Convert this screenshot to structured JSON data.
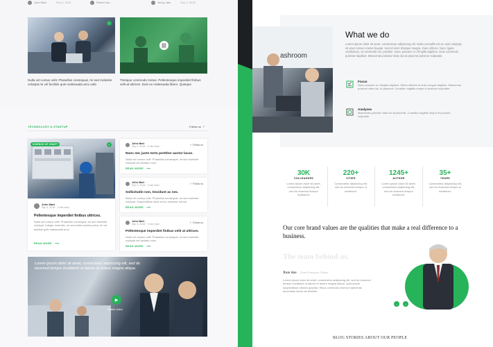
{
  "left": {
    "top_meta": [
      {
        "author": "John Mart",
        "date": "Sep 3, 2018"
      },
      {
        "author": "Robert Jan",
        "date": "Sep 2, 2018"
      }
    ],
    "top_meta_right": [
      {
        "author": "Jenny Jain",
        "date": "Sep 3, 2018"
      }
    ],
    "posts_row": [
      {
        "text": "Nulla vel cursus velit. Phasellus consequat, mi sed molestie volutpat mi vel facilisis quis malesuada arcu odio",
        "icon": "twitter-icon"
      },
      {
        "text": "Tristique commodo metus. Pellentesque imperdiet finibus velit at ultrices. Duis ex malesuada libero. Quisque",
        "icon": "link-icon"
      }
    ],
    "section_tag": "TECHNOLOGY & STARTUP",
    "follow_label": "Follow us",
    "featured": {
      "badge": "SCIENCE OF CRAFT",
      "author": "John Mart",
      "date": "Sep 3, 2018 · 3 min read",
      "title": "Pellentesque imperdiet finibus ultrices.",
      "excerpt": "Nulla vel cursus velit. Phasellus consequat, mi sed molestie volutpat. Integer molestie, mi sed mollis lacinia porta, mi vel facilisis quis malesuada arcu",
      "readmore": "READ MORE"
    },
    "side_posts": [
      {
        "author": "John Mart",
        "date": "Sep 3, 2018 · 3 min read",
        "follow": "Follow us",
        "title": "Nunc nec justo torto porttitor auctor lacus.",
        "excerpt": "Nulla vel cursus velit. Phasellus consequat, mi sed molestie volutpat vel facilisis nunc.",
        "readmore": "READ MORE"
      },
      {
        "author": "John Mart",
        "date": "Sep 3, 2018 · 3 min read",
        "follow": "Follow us",
        "title": "Sollicitudin non, tincidunt ac nec.",
        "excerpt": "Nulla vel cursus velit. Phasellus consequat, mi sed molestie volutpat. Suspendisse vitae et leo molestie rutrum.",
        "readmore": "READ MORE"
      },
      {
        "author": "John Mart",
        "date": "Sep 3, 2018 · 3 min read",
        "follow": "Follow us",
        "title": "Pellentesque imperdiet finibus velit at ultrices.",
        "excerpt": "Nulla vel cursus velit. Phasellus consequat, mi sed molestie volutpat vel facilisis nunc.",
        "readmore": "READ MORE"
      }
    ],
    "banner": {
      "quote": "Lorem ipsum dolor sit amet, consectetur adipiscing elit, sed do eiusmod tempor incididunt ut labore et dolore magna aliqua.",
      "play_label": "Watch video"
    }
  },
  "right": {
    "whatwedo": {
      "title": "What we do",
      "paragraph": "Lorem ipsum dolor sit amet, consectetur adipiscing elit. Nulla convallis est ac ante volutpat, sit amet rutrum metus feugiat. Sed id enim tristique magna. Duis ultrices. Nunc ligula vestibulum, at commodo nec porttitor. Nunc posuere eu fringilla dapibus. Duis commodo pulvinar dapibus. Maecenas pulvinar vitae dui at placerat pulvinar vulputate.",
      "features": [
        {
          "icon": "checklist-icon",
          "title": "Focus",
          "text": "Nunc posuere eu fringilla dapibus. Etiam ultrices et ante congue dapibus. Maecenas pulvinar vitae dui, at placerat. Curabitur sagittis neque id posuere vulputate."
        },
        {
          "icon": "analytics-icon",
          "title": "Analyses",
          "text": "Maecenas pulvinar vitae dui at placerat. Curabitur sagittis neque id posuere vulputate."
        }
      ]
    },
    "stats": [
      {
        "number": "30K",
        "label": "COLLEAGUES",
        "text": "Lorem ipsum dolor sit amet, consectetur adipiscing elit, sed do eiusmod tempor incididunt."
      },
      {
        "number": "220+",
        "label": "CITIES",
        "text": "Consectetur adipiscing elit, sed do eiusmod tempor in incididunt."
      },
      {
        "number": "1245+",
        "label": "AUTHOR",
        "text": "Lorem ipsum dolor sit amet, consectetur adipiscing elit, sed do eiusmod tempor incididunt."
      },
      {
        "number": "35+",
        "label": "YEARS",
        "text": "Consectetur adipiscing elit, sed do eiusmod tempor in incididunt."
      }
    ],
    "brand_values": "Our core brand values are the qualities that make a real difference to a business.",
    "team": {
      "title": "The team behind us.",
      "member_name": "Jhon doe",
      "member_role": "Chief Executive Officer",
      "bio": "Lorem ipsum dolor sit amet, consectetur adipiscing elit, sed do eiusmod tempor incididunt ut labore et dolore magna aliqua. Quis ipsum suspendisse ultrices gravida. Risus commodo viverra maecenas accumsan lacus vel facilisis."
    },
    "blog_heading": "BLOG STORIES ABOUT OUR PEOPLE"
  },
  "colors": {
    "accent": "#27b35a",
    "dark": "#1d2023"
  }
}
